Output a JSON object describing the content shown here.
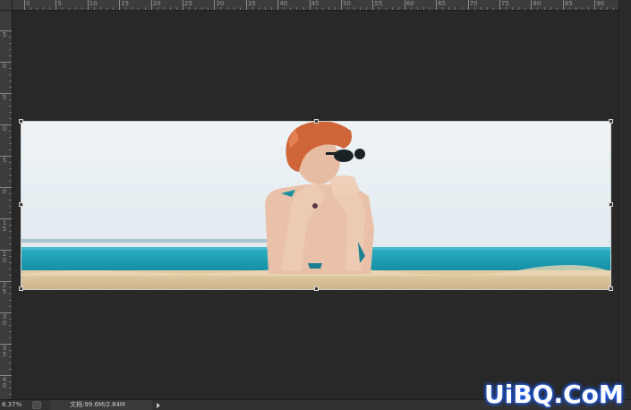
{
  "rulers": {
    "top_labels": [
      "0",
      "5",
      "10",
      "15",
      "20",
      "25",
      "30",
      "35",
      "40",
      "45",
      "50",
      "55",
      "60",
      "65",
      "70",
      "75",
      "80",
      "85",
      "90"
    ],
    "left_labels": [
      "5",
      "0",
      "5",
      "0",
      "5",
      "0",
      "1 5",
      "2 0",
      "2 5",
      "3 0",
      "3 5",
      "4 0"
    ]
  },
  "document": {
    "photo_subject": "woman-on-beach-panorama",
    "colors": {
      "sky": "#e6edf1",
      "sea": "#1fa0b4",
      "sand": "#d9c39a",
      "hair": "#d26a3c",
      "skin": "#e9c3ac"
    }
  },
  "status": {
    "zoom": "8.37%",
    "doc_info": "文档:99.6M/2.84M"
  },
  "watermark": {
    "text": "UiBQ.CoM"
  }
}
